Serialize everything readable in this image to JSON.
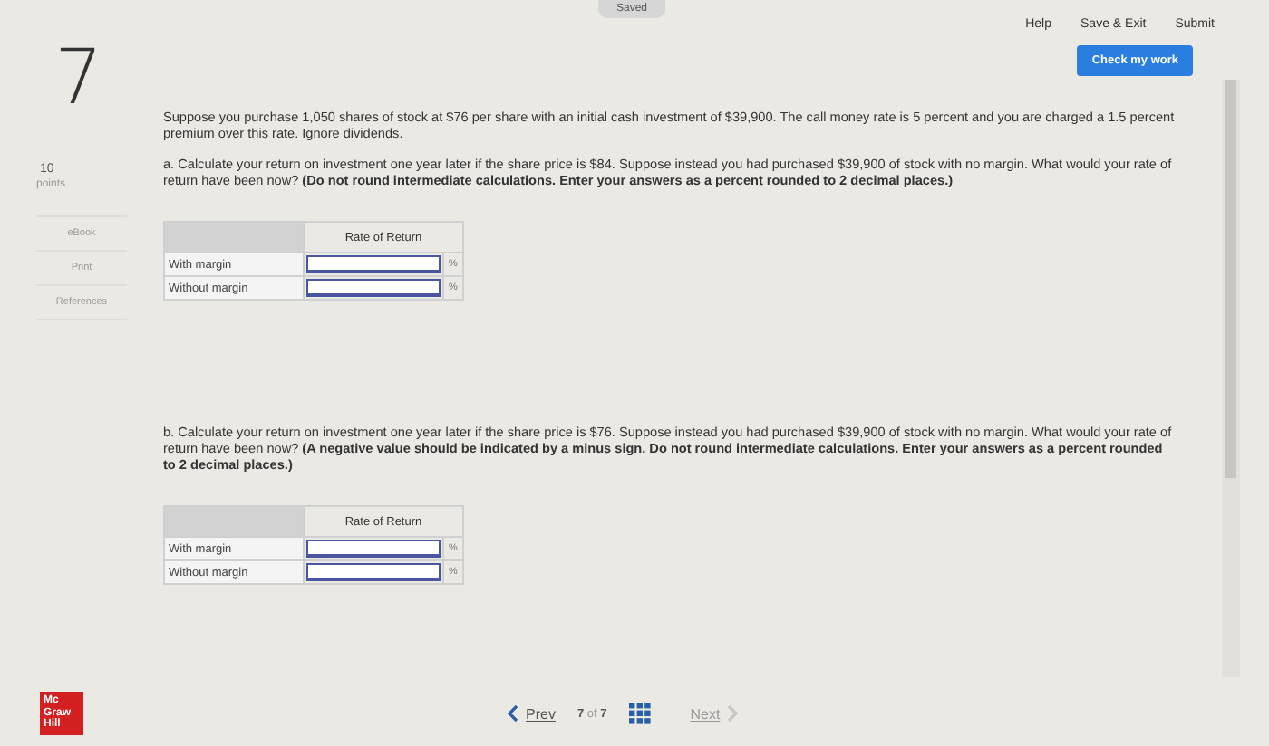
{
  "top_bar": {
    "status": "Saved",
    "links": [
      "Help",
      "Save & Exit",
      "Submit"
    ]
  },
  "question": {
    "number": "7",
    "points": "10",
    "points_label": "points",
    "check_button": "Check my work",
    "side_links": [
      "eBook",
      "Print",
      "References"
    ],
    "intro": "Suppose you purchase 1,050 shares of stock at $76 per share with an initial cash investment of $39,900. The call money rate is 5 percent and you are charged a 1.5 percent premium over this rate. Ignore dividends.",
    "parts": [
      {
        "text": "a. Calculate your return on investment one year later if the share price is $84. Suppose instead you had purchased $39,900 of stock with no margin. What would your rate of return have been now? **(Do not round intermediate calculations. Enter your answers as a percent rounded to 2 decimal places.)**",
        "table": {
          "column": "Rate of Return",
          "rows": [
            {
              "label": "With margin",
              "unit": "%"
            },
            {
              "label": "Without margin",
              "unit": "%"
            }
          ]
        }
      },
      {
        "text": "b. Calculate your return on investment one year later if the share price is $76. Suppose instead you had purchased $39,900 of stock with no margin. What would your rate of return have been now? **(A negative value should be indicated by a minus sign. Do not round intermediate calculations. Enter your answers as a percent rounded to 2 decimal places.)**",
        "table": {
          "column": "Rate of Return",
          "rows": [
            {
              "label": "With margin",
              "unit": "%"
            },
            {
              "label": "Without margin",
              "unit": "%"
            }
          ]
        }
      }
    ]
  },
  "footer": {
    "logo": [
      "Mc",
      "Graw",
      "Hill"
    ],
    "prev": "Prev",
    "page": "7",
    "of": "of",
    "total": "7",
    "next": "Next"
  }
}
